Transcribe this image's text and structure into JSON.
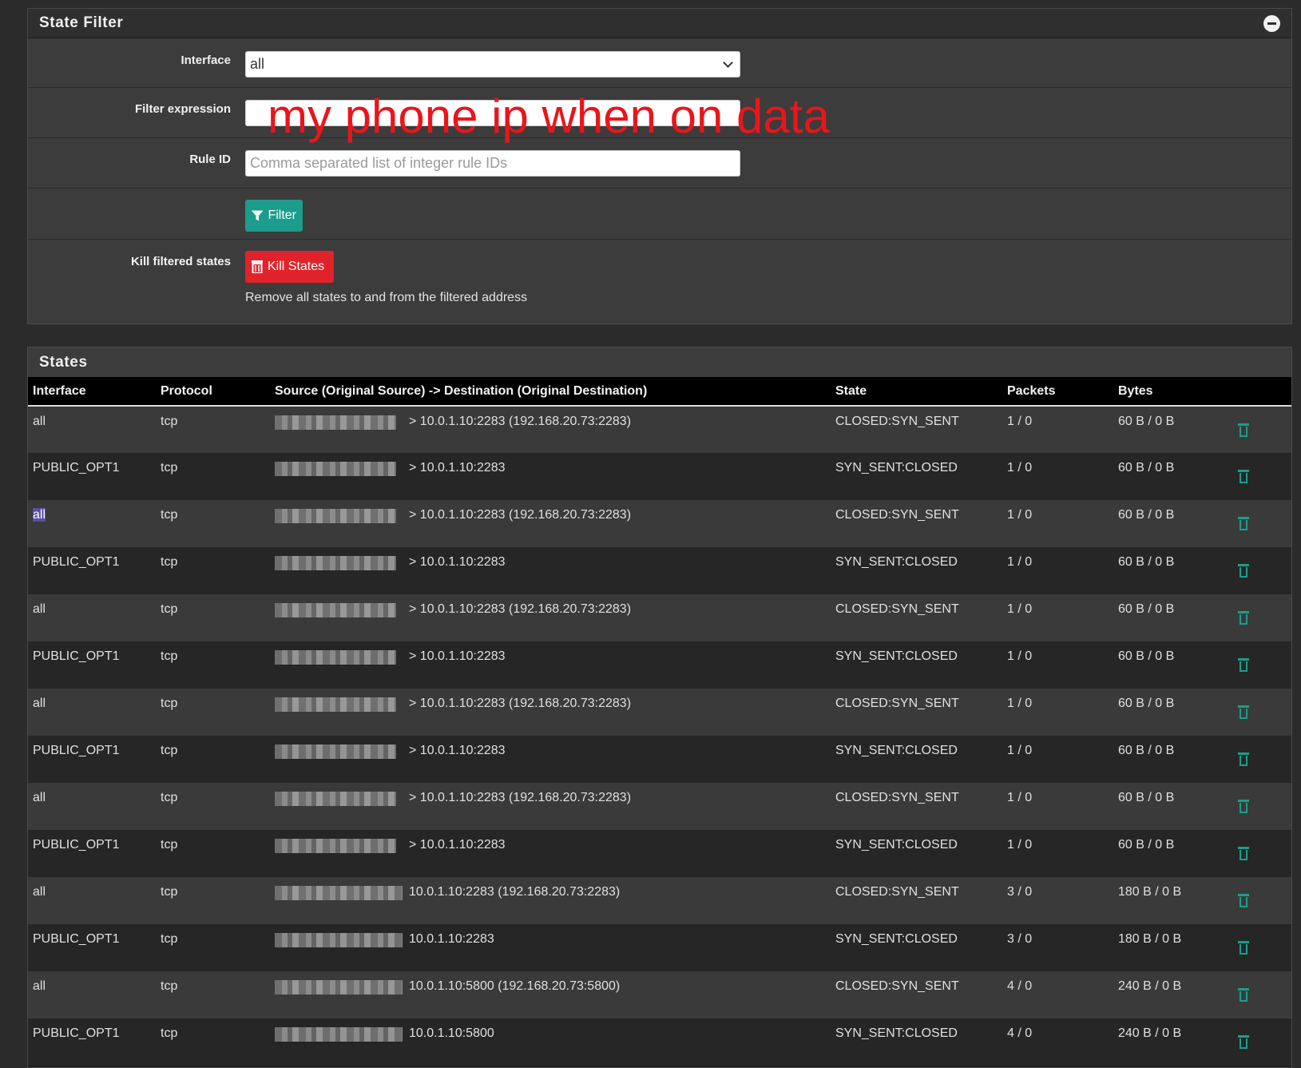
{
  "filter_panel": {
    "title": "State Filter",
    "interface_label": "Interface",
    "interface_value": "all",
    "filter_label": "Filter expression",
    "annotation": "my phone ip when on data",
    "ruleid_label": "Rule ID",
    "ruleid_placeholder": "Comma separated list of integer rule IDs",
    "filter_button": "Filter",
    "kill_label": "Kill filtered states",
    "kill_button": "Kill States",
    "kill_help": "Remove all states to and from the filtered address"
  },
  "states_panel": {
    "title": "States",
    "columns": [
      "Interface",
      "Protocol",
      "Source (Original Source) -> Destination (Original Destination)",
      "State",
      "Packets",
      "Bytes"
    ],
    "rows": [
      {
        "iface": "all",
        "proto": "tcp",
        "dest": "> 10.0.1.10:2283 (192.168.20.73:2283)",
        "state": "CLOSED:SYN_SENT",
        "packets": "1 / 0",
        "bytes": "60 B / 0 B"
      },
      {
        "iface": "PUBLIC_OPT1",
        "proto": "tcp",
        "dest": "> 10.0.1.10:2283",
        "state": "SYN_SENT:CLOSED",
        "packets": "1 / 0",
        "bytes": "60 B / 0 B"
      },
      {
        "iface": "all",
        "proto": "tcp",
        "dest": "> 10.0.1.10:2283 (192.168.20.73:2283)",
        "state": "CLOSED:SYN_SENT",
        "packets": "1 / 0",
        "bytes": "60 B / 0 B"
      },
      {
        "iface": "PUBLIC_OPT1",
        "proto": "tcp",
        "dest": "> 10.0.1.10:2283",
        "state": "SYN_SENT:CLOSED",
        "packets": "1 / 0",
        "bytes": "60 B / 0 B"
      },
      {
        "iface": "all",
        "proto": "tcp",
        "dest": "> 10.0.1.10:2283 (192.168.20.73:2283)",
        "state": "CLOSED:SYN_SENT",
        "packets": "1 / 0",
        "bytes": "60 B / 0 B"
      },
      {
        "iface": "PUBLIC_OPT1",
        "proto": "tcp",
        "dest": "> 10.0.1.10:2283",
        "state": "SYN_SENT:CLOSED",
        "packets": "1 / 0",
        "bytes": "60 B / 0 B"
      },
      {
        "iface": "all",
        "proto": "tcp",
        "dest": "> 10.0.1.10:2283 (192.168.20.73:2283)",
        "state": "CLOSED:SYN_SENT",
        "packets": "1 / 0",
        "bytes": "60 B / 0 B"
      },
      {
        "iface": "PUBLIC_OPT1",
        "proto": "tcp",
        "dest": "> 10.0.1.10:2283",
        "state": "SYN_SENT:CLOSED",
        "packets": "1 / 0",
        "bytes": "60 B / 0 B"
      },
      {
        "iface": "all",
        "proto": "tcp",
        "dest": "> 10.0.1.10:2283 (192.168.20.73:2283)",
        "state": "CLOSED:SYN_SENT",
        "packets": "1 / 0",
        "bytes": "60 B / 0 B"
      },
      {
        "iface": "PUBLIC_OPT1",
        "proto": "tcp",
        "dest": "> 10.0.1.10:2283",
        "state": "SYN_SENT:CLOSED",
        "packets": "1 / 0",
        "bytes": "60 B / 0 B"
      },
      {
        "iface": "all",
        "proto": "tcp",
        "dest": "10.0.1.10:2283 (192.168.20.73:2283)",
        "state": "CLOSED:SYN_SENT",
        "packets": "3 / 0",
        "bytes": "180 B / 0 B"
      },
      {
        "iface": "PUBLIC_OPT1",
        "proto": "tcp",
        "dest": "10.0.1.10:2283",
        "state": "SYN_SENT:CLOSED",
        "packets": "3 / 0",
        "bytes": "180 B / 0 B"
      },
      {
        "iface": "all",
        "proto": "tcp",
        "dest": "10.0.1.10:5800 (192.168.20.73:5800)",
        "state": "CLOSED:SYN_SENT",
        "packets": "4 / 0",
        "bytes": "240 B / 0 B"
      },
      {
        "iface": "PUBLIC_OPT1",
        "proto": "tcp",
        "dest": "10.0.1.10:5800",
        "state": "SYN_SENT:CLOSED",
        "packets": "4 / 0",
        "bytes": "240 B / 0 B"
      }
    ]
  },
  "colors": {
    "accent": "#1c9c8c",
    "danger": "#e0232b",
    "annotation": "#e8161c"
  }
}
